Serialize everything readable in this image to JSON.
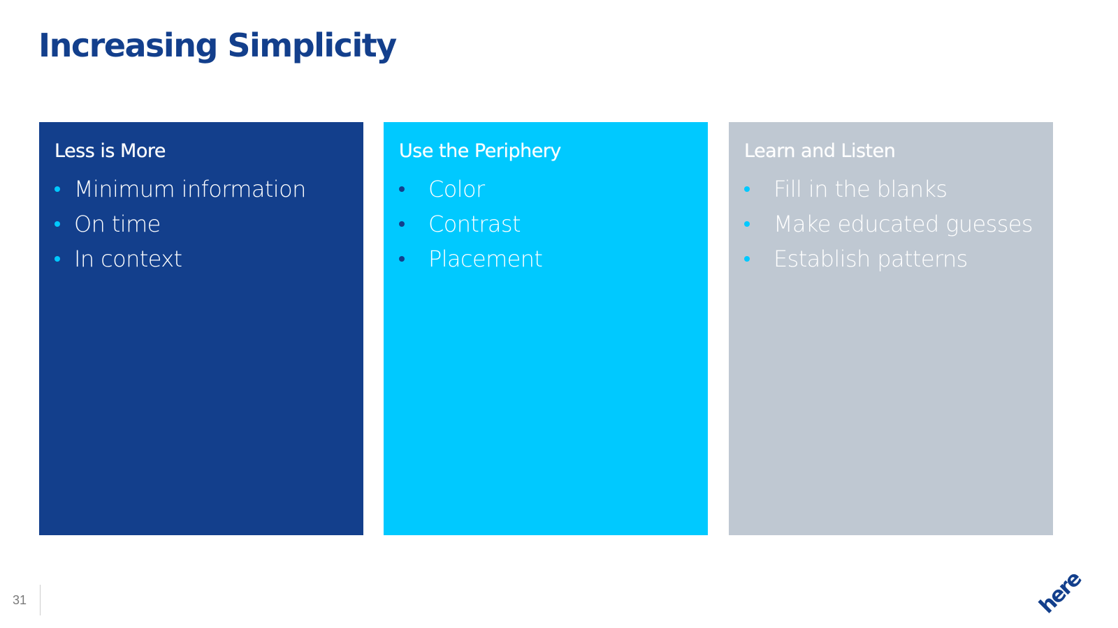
{
  "slide": {
    "title": "Increasing Simplicity",
    "page_number": "31",
    "logo_text": "here"
  },
  "colors": {
    "title": "#133f8c",
    "card1_bg": "#133f8c",
    "card2_bg": "#00c9ff",
    "card3_bg": "#bfc8d2",
    "bullet_light": "#00c9ff",
    "bullet_dark": "#133f8c"
  },
  "cards": [
    {
      "heading": "Less is More",
      "items": [
        "Minimum information",
        "On time",
        "In context"
      ]
    },
    {
      "heading": "Use the Periphery",
      "items": [
        "Color",
        "Contrast",
        "Placement"
      ]
    },
    {
      "heading": "Learn and Listen",
      "items": [
        "Fill in the blanks",
        "Make educated guesses",
        "Establish patterns"
      ]
    }
  ]
}
